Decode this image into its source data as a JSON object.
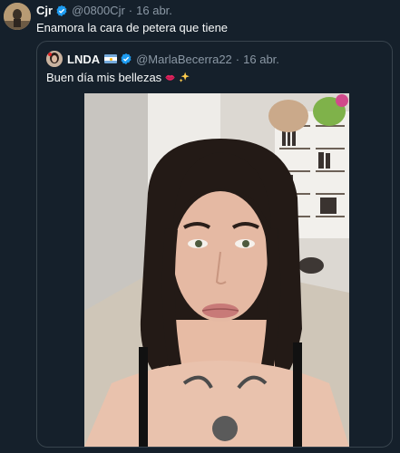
{
  "tweet": {
    "author_name": "Cjr",
    "author_handle": "@0800Cjr",
    "separator": "·",
    "date": "16 abr.",
    "text": "Enamora la cara de petera que tiene"
  },
  "quoted": {
    "author_name": "LNDA",
    "author_handle": "@MarlaBecerra22",
    "separator": "·",
    "date": "16 abr.",
    "text": "Buen día mis bellezas"
  },
  "colors": {
    "background": "#15202b",
    "verified": "#1d9bf0",
    "secondary_text": "#8b98a5",
    "border": "#38444d"
  },
  "icons": [
    "verified-badge-icon",
    "argentina-flag-icon",
    "kiss-lips-emoji-icon",
    "sparkles-emoji-icon"
  ]
}
